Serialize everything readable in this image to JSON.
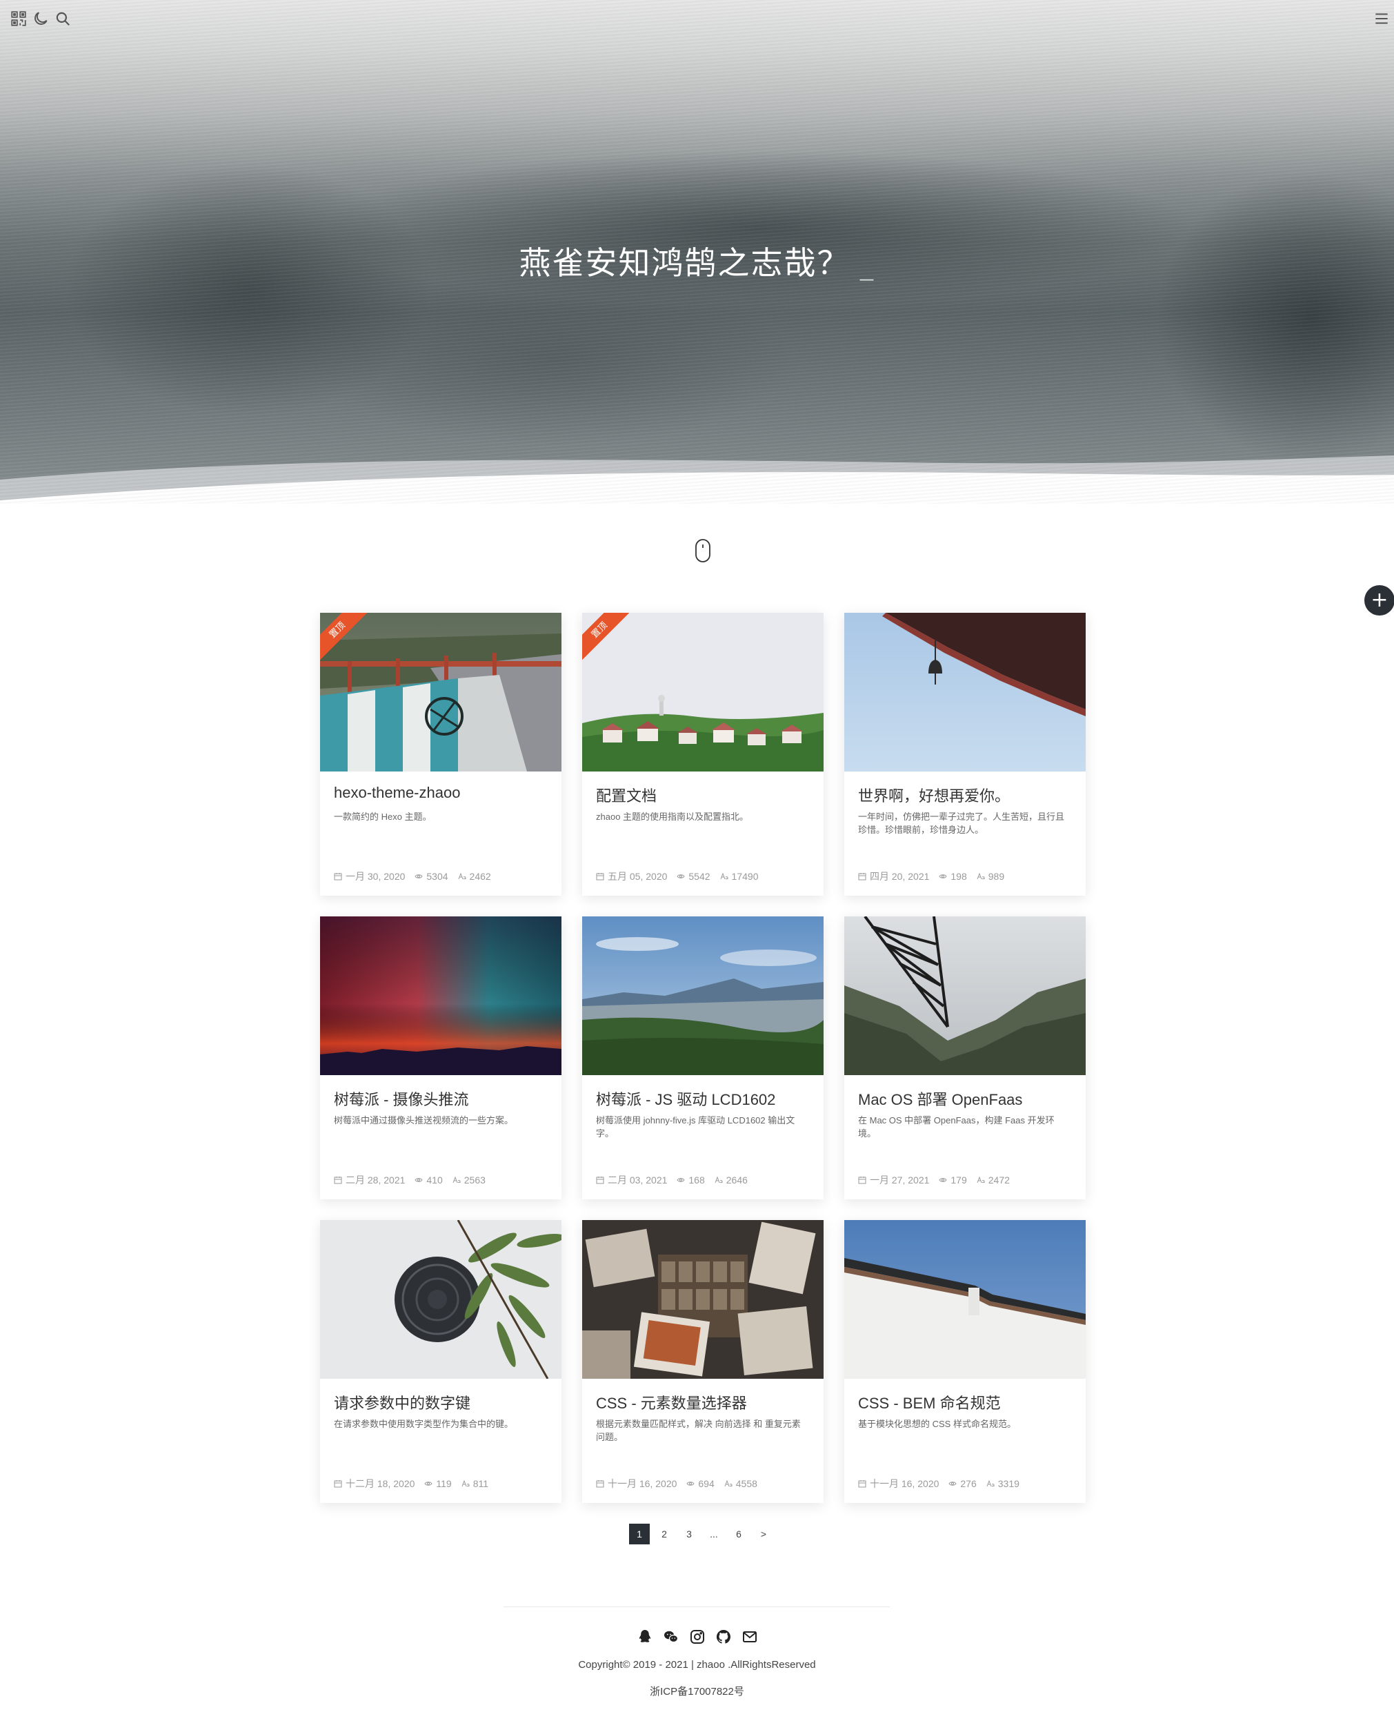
{
  "hero": {
    "title": "燕雀安知鸿鹄之志哉？",
    "cursor": "_"
  },
  "topbar": {
    "icons": [
      "qrcode-icon",
      "moon-icon",
      "search-icon",
      "menu-icon"
    ]
  },
  "fab": {
    "label": "+"
  },
  "posts": [
    {
      "title": "hexo-theme-zhaoo",
      "excerpt": "一款简约的 Hexo 主题。",
      "date": "一月 30, 2020",
      "views": "5304",
      "words": "2462",
      "pinned": true,
      "pin_label": "置顶"
    },
    {
      "title": "配置文档",
      "excerpt": "zhaoo 主题的使用指南以及配置指北。",
      "date": "五月 05, 2020",
      "views": "5542",
      "words": "17490",
      "pinned": true,
      "pin_label": "置顶"
    },
    {
      "title": "世界啊，好想再爱你。",
      "excerpt": "一年时间，仿佛把一辈子过完了。人生苦短，且行且珍惜。珍惜眼前，珍惜身边人。",
      "date": "四月 20, 2021",
      "views": "198",
      "words": "989",
      "pinned": false
    },
    {
      "title": "树莓派 - 摄像头推流",
      "excerpt": "树莓派中通过摄像头推送视频流的一些方案。",
      "date": "二月 28, 2021",
      "views": "410",
      "words": "2563",
      "pinned": false
    },
    {
      "title": "树莓派 - JS 驱动 LCD1602",
      "excerpt": "树莓派使用 johnny-five.js 库驱动 LCD1602 输出文字。",
      "date": "二月 03, 2021",
      "views": "168",
      "words": "2646",
      "pinned": false
    },
    {
      "title": "Mac OS 部署 OpenFaas",
      "excerpt": "在 Mac OS 中部署 OpenFaas，构建 Faas 开发环境。",
      "date": "一月 27, 2021",
      "views": "179",
      "words": "2472",
      "pinned": false
    },
    {
      "title": "请求参数中的数字键",
      "excerpt": "在请求参数中使用数字类型作为集合中的键。",
      "date": "十二月 18, 2020",
      "views": "119",
      "words": "811",
      "pinned": false
    },
    {
      "title": "CSS - 元素数量选择器",
      "excerpt": "根据元素数量匹配样式，解决 向前选择 和 重复元素 问题。",
      "date": "十一月 16, 2020",
      "views": "694",
      "words": "4558",
      "pinned": false
    },
    {
      "title": "CSS - BEM 命名规范",
      "excerpt": "基于模块化思想的 CSS 样式命名规范。",
      "date": "十一月 16, 2020",
      "views": "276",
      "words": "3319",
      "pinned": false
    }
  ],
  "pagination": {
    "pages": [
      "1",
      "2",
      "3",
      "...",
      "6"
    ],
    "current": "1",
    "next": ">"
  },
  "footer": {
    "social_icons": [
      "qq-icon",
      "wechat-icon",
      "instagram-icon",
      "github-icon",
      "mail-icon"
    ],
    "copyright": "Copyright© 2019 - 2021 | zhaoo .AllRightsReserved",
    "icp": "浙ICP备17007822号"
  }
}
